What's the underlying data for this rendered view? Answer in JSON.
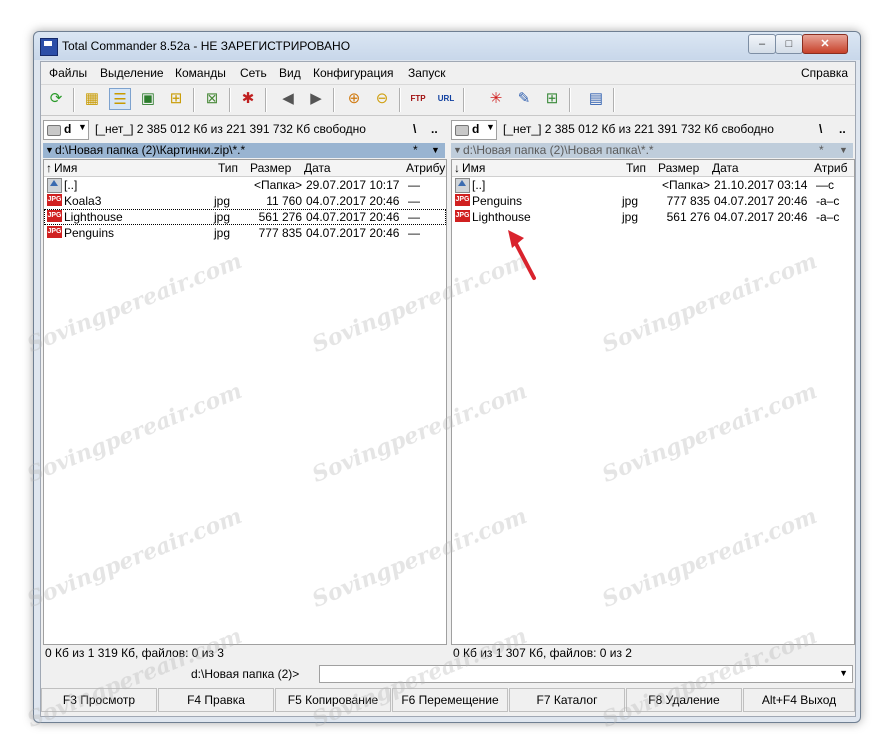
{
  "window": {
    "title": "Total Commander 8.52a - НЕ ЗАРЕГИСТРИРОВАНО",
    "controls": {
      "min": "–",
      "max": "□",
      "close": "✕"
    }
  },
  "menu": [
    "Файлы",
    "Выделение",
    "Команды",
    "Сеть",
    "Вид",
    "Конфигурация",
    "Запуск"
  ],
  "menu_help": "Справка",
  "toolbar_icons": [
    "refresh-icon",
    "brief-view-icon",
    "detailed-view-icon",
    "thumbnails-view-icon",
    "tree-view-icon",
    "invert-selection-icon",
    "pack-icon",
    "back-icon",
    "forward-icon",
    "pack-files-icon",
    "unpack-files-icon",
    "ftp-connect-icon",
    "url-connect-icon",
    "find-icon",
    "rename-icon",
    "compare-dirs-icon",
    "notepad-icon"
  ],
  "left": {
    "drive": "d",
    "drive_info": "[_нет_]  2 385 012 Кб из 221 391 732 Кб свободно",
    "root": "\\",
    "up": "..",
    "path": "d:\\Новая папка (2)\\Картинки.zip\\*.*",
    "path_star": "*",
    "path_arrow": "▼",
    "headers": {
      "name": "Имя",
      "type": "Тип",
      "size": "Размер",
      "date": "Дата",
      "attr": "Атрибу"
    },
    "files": [
      {
        "name": "[..]",
        "type": "",
        "size": "<Папка>",
        "date": "29.07.2017 10:17",
        "attr": "—"
      },
      {
        "name": "Koala3",
        "type": "jpg",
        "size": "11 760",
        "date": "04.07.2017 20:46",
        "attr": "—"
      },
      {
        "name": "Lighthouse",
        "type": "jpg",
        "size": "561 276",
        "date": "04.07.2017 20:46",
        "attr": "—"
      },
      {
        "name": "Penguins",
        "type": "jpg",
        "size": "777 835",
        "date": "04.07.2017 20:46",
        "attr": "—"
      }
    ],
    "status": "0 Кб из 1 319 Кб, файлов: 0 из 3"
  },
  "right": {
    "drive": "d",
    "drive_info": "[_нет_]  2 385 012 Кб из 221 391 732 Кб свободно",
    "root": "\\",
    "up": "..",
    "path": "d:\\Новая папка (2)\\Новая папка\\*.*",
    "path_star": "*",
    "path_arrow": "▼",
    "headers": {
      "name": "Имя",
      "type": "Тип",
      "size": "Размер",
      "date": "Дата",
      "attr": "Атриб"
    },
    "files": [
      {
        "name": "[..]",
        "type": "",
        "size": "<Папка>",
        "date": "21.10.2017 03:14",
        "attr": "—c"
      },
      {
        "name": "Penguins",
        "type": "jpg",
        "size": "777 835",
        "date": "04.07.2017 20:46",
        "attr": "-a–c"
      },
      {
        "name": "Lighthouse",
        "type": "jpg",
        "size": "561 276",
        "date": "04.07.2017 20:46",
        "attr": "-a–c"
      }
    ],
    "status": "0 Кб из 1 307 Кб, файлов: 0 из 2"
  },
  "cmdline": {
    "label": "d:\\Новая папка (2)>",
    "value": "",
    "arrow": "▼"
  },
  "fkeys": [
    "F3 Просмотр",
    "F4 Правка",
    "F5 Копирование",
    "F6 Перемещение",
    "F7 Каталог",
    "F8 Удаление",
    "Alt+F4 Выход"
  ],
  "file_icon_text": "JPG",
  "watermark": "Sovingpereair.com",
  "colors": {
    "active_path": "#99b4d1",
    "inactive_path": "#bfcddb",
    "annotation_arrow": "#d9232d"
  }
}
